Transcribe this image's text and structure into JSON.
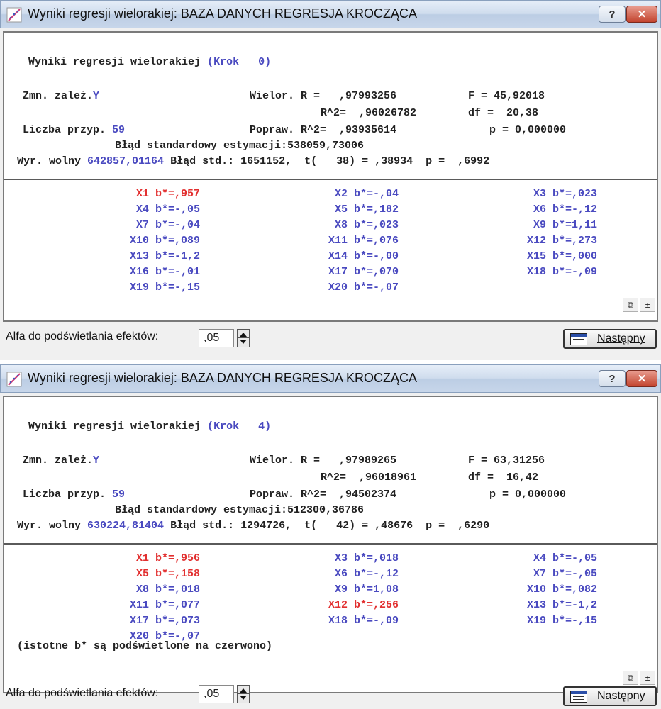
{
  "windows": [
    {
      "title": "Wyniki regresji wielorakiej: BAZA DANYCH REGRESJA KROCZĄCA",
      "help_label": "?",
      "close_label": "✕",
      "header": {
        "heading_label": "Wyniki regresji wielorakiej",
        "heading_step": "(Krok   0)",
        "dep_label": "Zmn. zależ.",
        "dep_value": "Y",
        "multiple_r": "Wielor. R =   ,97993256",
        "r2": "R^2=  ,96026782",
        "adj_r2": "Popraw. R^2=  ,93935614",
        "f": "F = 45,92018",
        "df": "df =  20,38",
        "p": "p = 0,000000",
        "cases_label": "Liczba przyp.",
        "cases_value": "59",
        "se_est": "Błąd standardowy estymacji:538059,73006",
        "intercept_label": "Wyr. wolny",
        "intercept_value": "642857,01164",
        "intercept_rest": "Błąd std.: 1651152,  t(   38) = ,38934  p =  ,6992"
      },
      "coefficients": [
        {
          "text": "X1 b*=,957",
          "significant": true
        },
        {
          "text": "X2 b*=-,04",
          "significant": false
        },
        {
          "text": "X3 b*=,023",
          "significant": false
        },
        {
          "text": "X4 b*=-,05",
          "significant": false
        },
        {
          "text": "X5 b*=,182",
          "significant": false
        },
        {
          "text": "X6 b*=-,12",
          "significant": false
        },
        {
          "text": "X7 b*=-,04",
          "significant": false
        },
        {
          "text": "X8 b*=,023",
          "significant": false
        },
        {
          "text": "X9 b*=1,11",
          "significant": false
        },
        {
          "text": "X10 b*=,089",
          "significant": false
        },
        {
          "text": "X11 b*=,076",
          "significant": false
        },
        {
          "text": "X12 b*=,273",
          "significant": false
        },
        {
          "text": "X13 b*=-1,2",
          "significant": false
        },
        {
          "text": "X14 b*=-,00",
          "significant": false
        },
        {
          "text": "X15 b*=,000",
          "significant": false
        },
        {
          "text": "X16 b*=-,01",
          "significant": false
        },
        {
          "text": "X17 b*=,070",
          "significant": false
        },
        {
          "text": "X18 b*=-,09",
          "significant": false
        },
        {
          "text": "X19 b*=-,15",
          "significant": false
        },
        {
          "text": "X20 b*=-,07",
          "significant": false
        }
      ],
      "note": "",
      "copy_icon": "⧉",
      "expand_icon": "±",
      "footer": {
        "alpha_label": "Alfa do podświetlania efektów:",
        "alpha_value": ",05",
        "next_label": "Następny"
      }
    },
    {
      "title": "Wyniki regresji wielorakiej: BAZA DANYCH REGRESJA KROCZĄCA",
      "help_label": "?",
      "close_label": "✕",
      "header": {
        "heading_label": "Wyniki regresji wielorakiej",
        "heading_step": "(Krok   4)",
        "dep_label": "Zmn. zależ.",
        "dep_value": "Y",
        "multiple_r": "Wielor. R =   ,97989265",
        "r2": "R^2=  ,96018961",
        "adj_r2": "Popraw. R^2=  ,94502374",
        "f": "F = 63,31256",
        "df": "df =  16,42",
        "p": "p = 0,000000",
        "cases_label": "Liczba przyp.",
        "cases_value": "59",
        "se_est": "Błąd standardowy estymacji:512300,36786",
        "intercept_label": "Wyr. wolny",
        "intercept_value": "630224,81404",
        "intercept_rest": "Błąd std.: 1294726,  t(   42) = ,48676  p =  ,6290"
      },
      "coefficients": [
        {
          "text": "X1 b*=,956",
          "significant": true
        },
        {
          "text": "X3 b*=,018",
          "significant": false
        },
        {
          "text": "X4 b*=-,05",
          "significant": false
        },
        {
          "text": "X5 b*=,158",
          "significant": true
        },
        {
          "text": "X6 b*=-,12",
          "significant": false
        },
        {
          "text": "X7 b*=-,05",
          "significant": false
        },
        {
          "text": "X8 b*=,018",
          "significant": false
        },
        {
          "text": "X9 b*=1,08",
          "significant": false
        },
        {
          "text": "X10 b*=,082",
          "significant": false
        },
        {
          "text": "X11 b*=,077",
          "significant": false
        },
        {
          "text": "X12 b*=,256",
          "significant": true
        },
        {
          "text": "X13 b*=-1,2",
          "significant": false
        },
        {
          "text": "X17 b*=,073",
          "significant": false
        },
        {
          "text": "X18 b*=-,09",
          "significant": false
        },
        {
          "text": "X19 b*=-,15",
          "significant": false
        },
        {
          "text": "X20 b*=-,07",
          "significant": false
        }
      ],
      "note": "(istotne b* są podświetlone na czerwono)",
      "copy_icon": "⧉",
      "expand_icon": "±",
      "footer": {
        "alpha_label": "Alfa do podświetlania efektów:",
        "alpha_value": ",05",
        "next_label": "Następny"
      }
    }
  ],
  "colors": {
    "blue_text": "#4a4ac0",
    "red_text": "#e23030",
    "dark_text": "#222222"
  }
}
